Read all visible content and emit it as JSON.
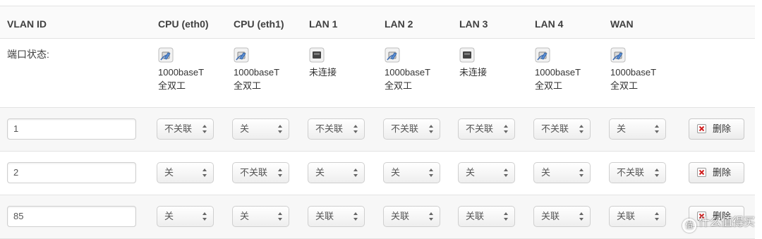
{
  "header": {
    "vlan_id": "VLAN ID",
    "cpu_eth0": "CPU (eth0)",
    "cpu_eth1": "CPU (eth1)",
    "lan1": "LAN 1",
    "lan2": "LAN 2",
    "lan3": "LAN 3",
    "lan4": "LAN 4",
    "wan": "WAN"
  },
  "status": {
    "label": "端口状态:",
    "ports": [
      {
        "icon": "ethernet-connected-icon",
        "line1": "1000baseT",
        "line2": "全双工"
      },
      {
        "icon": "ethernet-connected-icon",
        "line1": "1000baseT",
        "line2": "全双工"
      },
      {
        "icon": "ethernet-disconnected-icon",
        "line1": "未连接",
        "line2": ""
      },
      {
        "icon": "ethernet-connected-icon",
        "line1": "1000baseT",
        "line2": "全双工"
      },
      {
        "icon": "ethernet-disconnected-icon",
        "line1": "未连接",
        "line2": ""
      },
      {
        "icon": "ethernet-connected-icon",
        "line1": "1000baseT",
        "line2": "全双工"
      },
      {
        "icon": "ethernet-connected-icon",
        "line1": "1000baseT",
        "line2": "全双工"
      }
    ]
  },
  "vlans": [
    {
      "id": "1",
      "ports": [
        "不关联",
        "关",
        "不关联",
        "不关联",
        "不关联",
        "不关联",
        "关"
      ],
      "delete_label": "删除"
    },
    {
      "id": "2",
      "ports": [
        "关",
        "不关联",
        "关",
        "关",
        "关",
        "关",
        "不关联"
      ],
      "delete_label": "删除"
    },
    {
      "id": "85",
      "ports": [
        "关",
        "关",
        "关联",
        "关联",
        "关联",
        "关联",
        "关联"
      ],
      "delete_label": "删除"
    }
  ],
  "watermark": {
    "symbol": "值",
    "text": "什么值得买"
  }
}
